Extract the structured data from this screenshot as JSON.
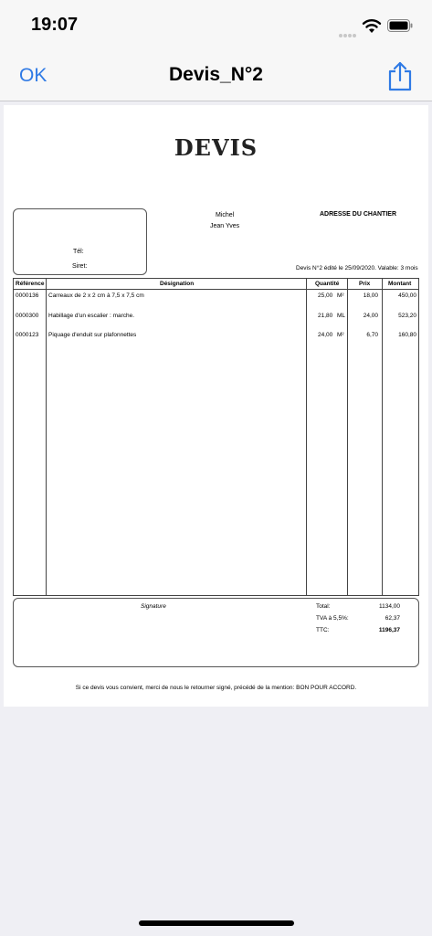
{
  "status": {
    "time": "19:07"
  },
  "nav": {
    "ok_label": "OK",
    "title": "Devis_N°2"
  },
  "doc": {
    "title": "DEVIS",
    "client": {
      "tel_label": "Tél:",
      "siret_label": "Siret:"
    },
    "sender": {
      "line1": "Michel",
      "line2": "Jean Yves"
    },
    "site_address_label": "ADRESSE DU CHANTIER",
    "devis_info": "Devis N°2 édité le 25/09/2020. Valable: 3 mois",
    "table": {
      "headers": [
        "Référence",
        "Désignation",
        "Quantité",
        "Prix",
        "Montant"
      ],
      "rows": [
        {
          "ref": "0000136",
          "designation": "Carreaux de 2 x 2 cm à 7,5 x 7,5 cm",
          "qty": "25,00",
          "unit": "M²",
          "price": "18,00",
          "amount": "450,00"
        },
        {
          "ref": "0000300",
          "designation": "Habillage d'un escalier : marche.",
          "qty": "21,80",
          "unit": "ML",
          "price": "24,00",
          "amount": "523,20"
        },
        {
          "ref": "0000123",
          "designation": "Piquage d'enduit sur plafonnettes",
          "qty": "24,00",
          "unit": "M²",
          "price": "6,70",
          "amount": "160,80"
        }
      ]
    },
    "totals": {
      "signature_label": "Signature",
      "total_label": "Total:",
      "total_value": "1134,00",
      "tva_label": "TVA à 5,5%:",
      "tva_value": "62,37",
      "ttc_label": "TTC:",
      "ttc_value": "1196,37"
    },
    "footer": "Si ce devis vous convient, merci de nous le retourner signé, précédé de la mention: BON POUR ACCORD."
  }
}
